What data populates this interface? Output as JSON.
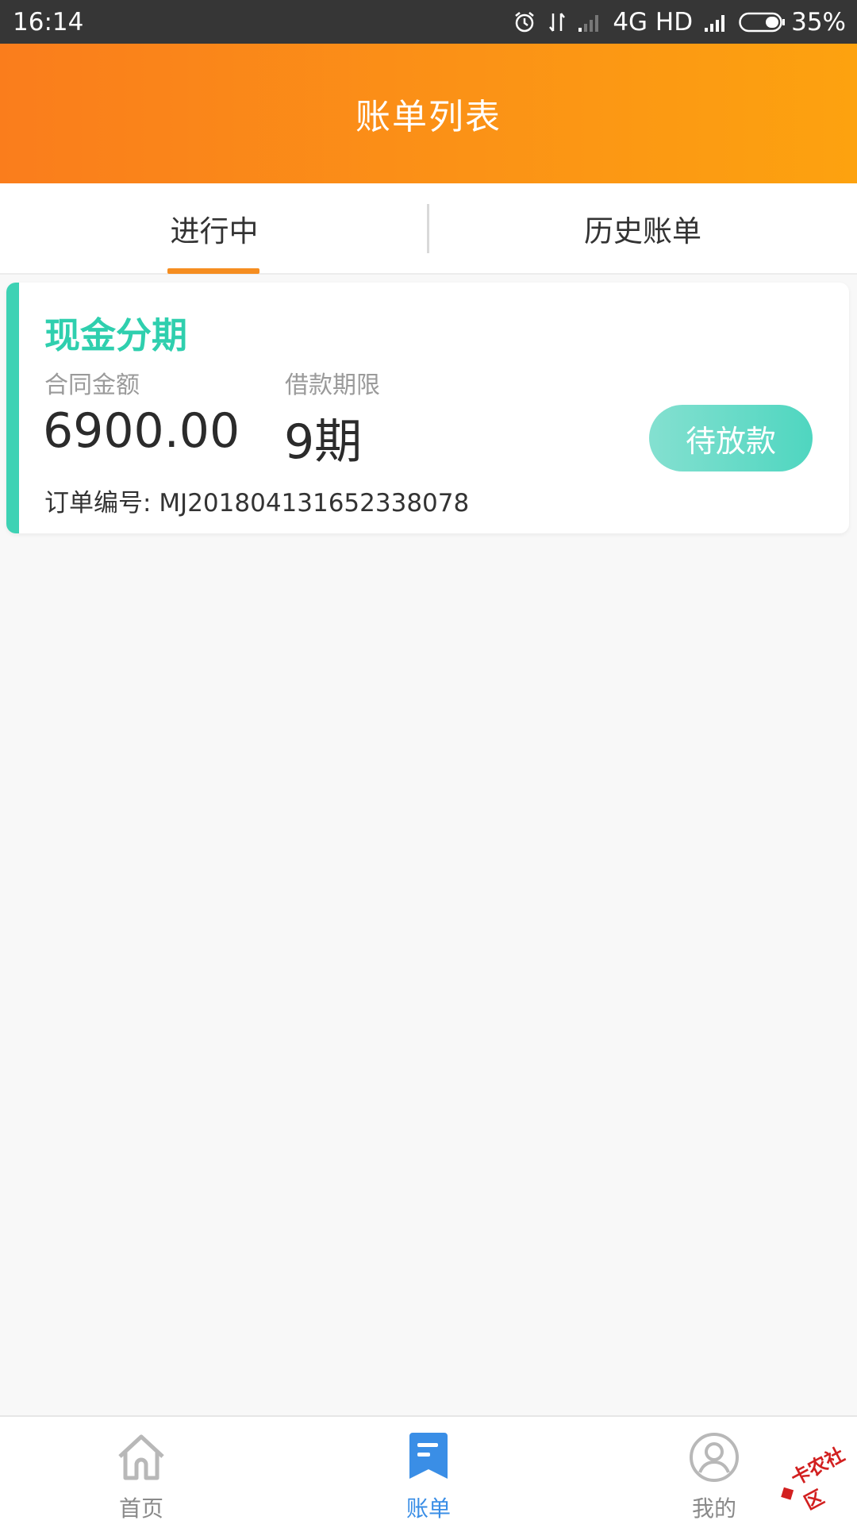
{
  "status_bar": {
    "time": "16:14",
    "network": "4G HD",
    "battery": "35%"
  },
  "header": {
    "title": "账单列表"
  },
  "tabs": [
    {
      "label": "进行中",
      "active": true
    },
    {
      "label": "历史账单",
      "active": false
    }
  ],
  "bill": {
    "product_name": "现金分期",
    "amount_label": "合同金额",
    "amount_value": "6900.00",
    "term_label": "借款期限",
    "term_value": "9期",
    "order_label": "订单编号:",
    "order_no": "MJ201804131652338078",
    "status": "待放款"
  },
  "bottom_nav": [
    {
      "label": "首页",
      "icon": "home-icon",
      "active": false
    },
    {
      "label": "账单",
      "icon": "bill-icon",
      "active": true
    },
    {
      "label": "我的",
      "icon": "profile-icon",
      "active": false
    }
  ],
  "watermark": {
    "text": "卡农社区"
  },
  "colors": {
    "header_start": "#fa7d1c",
    "header_end": "#fda20f",
    "tab_indicator": "#f58d20",
    "teal_accent": "#3dd2b4",
    "nav_active": "#3a8ee6",
    "nav_inactive": "#b8b8b8"
  }
}
